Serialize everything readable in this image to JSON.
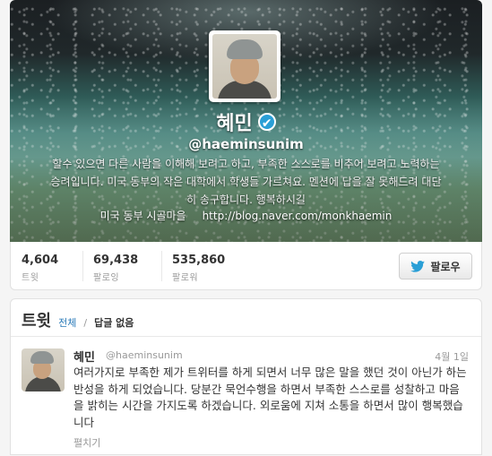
{
  "profile": {
    "display_name": "혜민",
    "verified_mark": "✔",
    "handle": "@haeminsunim",
    "bio": "할수 있으면 다른 사람을 이해해 보려고 하고, 부족한 스스로를 비추어 보려고 노력하는 승려입니다. 미국 동부의 작은 대학에서 학생들 가르쳐요. 멘션에 답을 잘 못해드려 대단히 송구합니다. 행복하시길",
    "location": "미국 동부 시골마을",
    "url": "http://blog.naver.com/monkhaemin"
  },
  "stats": [
    {
      "value": "4,604",
      "label": "트윗"
    },
    {
      "value": "69,438",
      "label": "팔로잉"
    },
    {
      "value": "535,860",
      "label": "팔로워"
    }
  ],
  "follow_button": {
    "label": "팔로우",
    "icon": "twitter-bird-icon",
    "icon_color": "#2a9fd6"
  },
  "tweets_panel": {
    "title": "트윗",
    "filter_all": "전체",
    "filter_separator": "/",
    "filter_no_replies": "답글 없음"
  },
  "tweet": {
    "name": "혜민",
    "handle": "@haeminsunim",
    "date": "4월 1일",
    "text": "여러가지로 부족한 제가 트위터를 하게 되면서 너무 많은 말을 했던 것이 아닌가 하는 반성을 하게 되었습니다. 당분간 묵언수행을 하면서 부족한 스스로를 성찰하고 마음을 밝히는 시간을 가지도록 하겠습니다. 외로움에 지쳐 소통을 하면서 많이 행복했습니다",
    "expand": "펼치기"
  }
}
